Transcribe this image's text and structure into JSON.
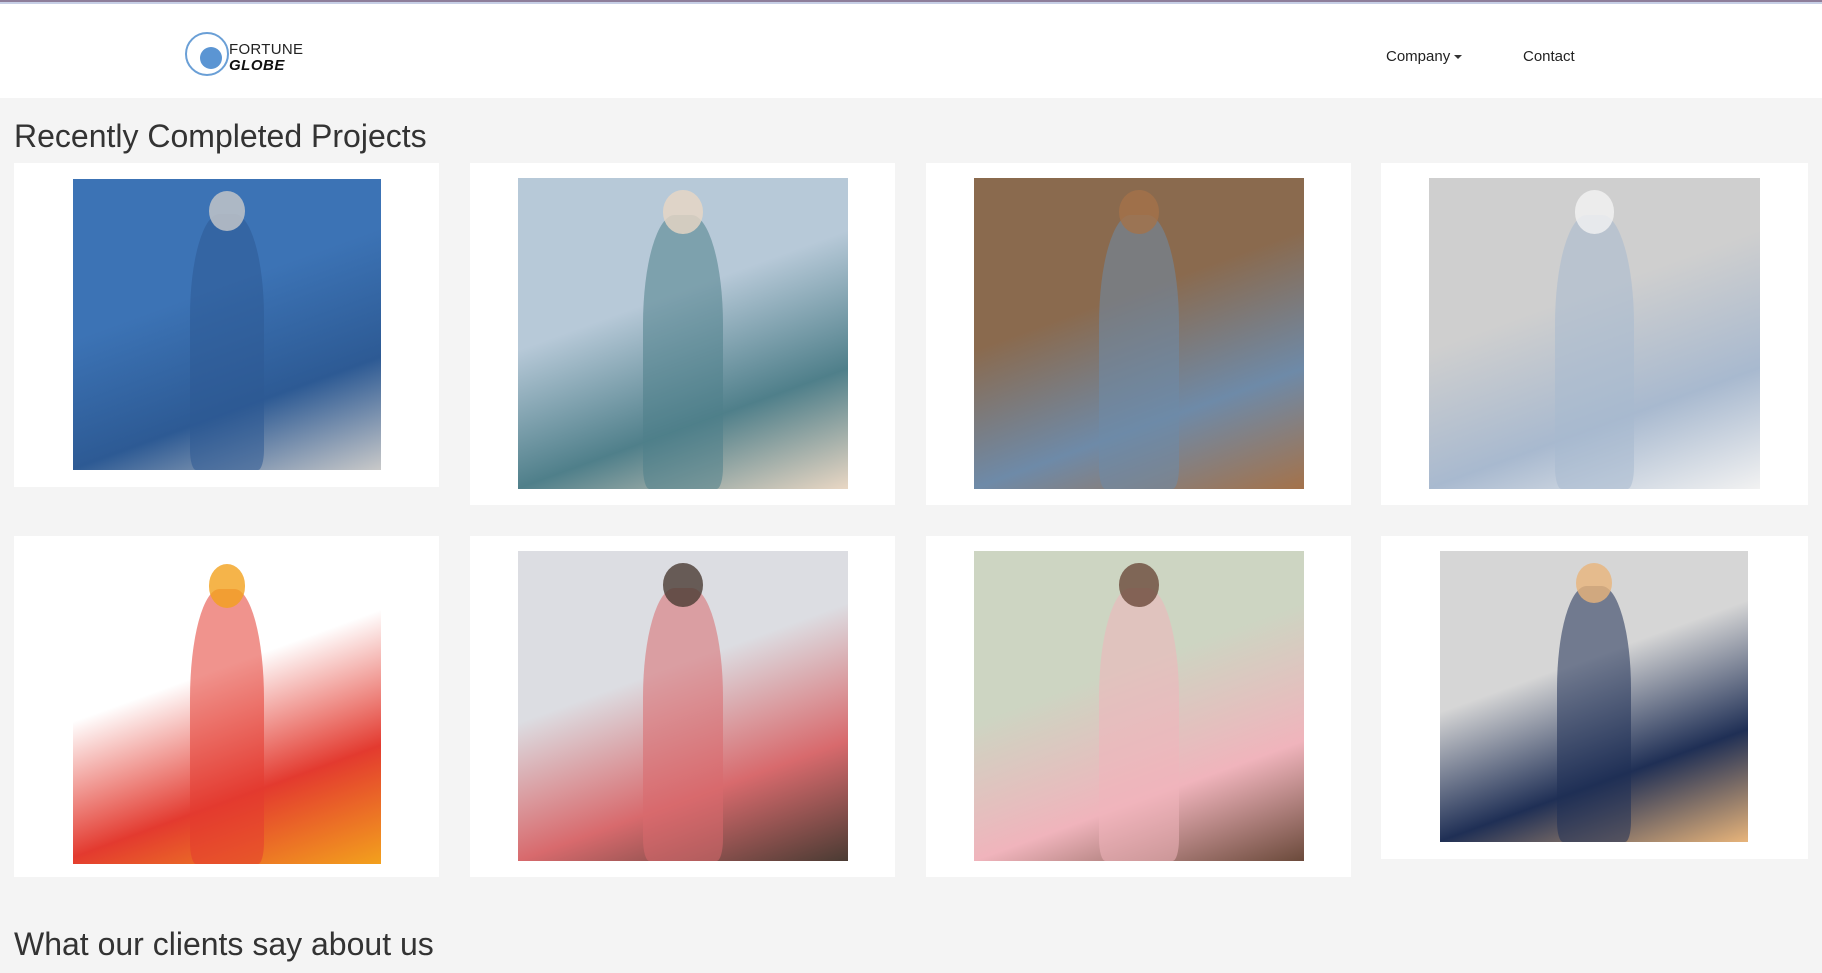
{
  "brand": {
    "line1": "FORTUNE",
    "line2": "GLOBE"
  },
  "nav": {
    "company": "Company",
    "contact": "Contact"
  },
  "sections": {
    "projects_title": "Recently Completed Projects",
    "clients_title": "What our clients say about us"
  },
  "projects": [
    {
      "image": "man-in-blue-blazer",
      "palette": [
        "#3c73b5",
        "#2d5a94",
        "#c9c9c9"
      ]
    },
    {
      "image": "man-on-beach-in-striped-polo",
      "palette": [
        "#b7c9d8",
        "#4f7f8a",
        "#e9d7c4"
      ]
    },
    {
      "image": "couple-on-leather-sofa",
      "palette": [
        "#8a6a4e",
        "#6e8aa8",
        "#a4724a"
      ]
    },
    {
      "image": "man-in-light-blazer",
      "palette": [
        "#cfcfcf",
        "#a8b9cf",
        "#f2f2f2"
      ]
    },
    {
      "image": "illustrated-swimwear-couple",
      "palette": [
        "#ffffff",
        "#e33a2f",
        "#f3a11d"
      ]
    },
    {
      "image": "man-in-red-checked-shirt",
      "palette": [
        "#dcdde2",
        "#d86a6d",
        "#4a3b33"
      ]
    },
    {
      "image": "woman-in-pink-blouse",
      "palette": [
        "#cdd5c2",
        "#f0b4bc",
        "#6b4a3b"
      ]
    },
    {
      "image": "two-men-in-sunglasses",
      "palette": [
        "#d6d6d6",
        "#1f2f55",
        "#e8b47a"
      ]
    }
  ]
}
